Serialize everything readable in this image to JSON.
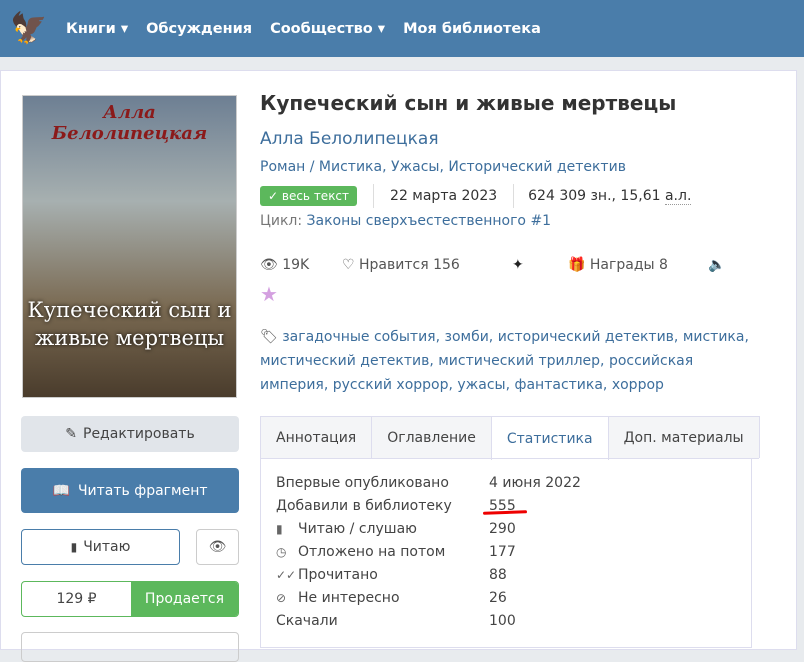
{
  "nav": {
    "items": [
      "Книги ▾",
      "Обсуждения",
      "Сообщество ▾",
      "Моя библиотека"
    ]
  },
  "cover": {
    "author": "Алла Белолипецкая",
    "title": "Купеческий сын и живые мертвецы"
  },
  "book": {
    "title": "Купеческий сын и живые мертвецы",
    "author": "Алла Белолипецкая",
    "genres": "Роман / Мистика, Ужасы, Исторический детектив",
    "status": "весь текст",
    "date": "22 марта 2023",
    "size": "624 309 зн., 15,61",
    "size_unit": "а.л.",
    "cycle_label": "Цикл:",
    "cycle": "Законы сверхъестественного #1",
    "views": "19K",
    "likes": "Нравится 156",
    "awards": "Награды 8",
    "tags": "загадочные события, зомби, исторический детектив, мистика, мистический детектив, мистический триллер, российская империя, русский хоррор, ужасы, фантастика, хоррор"
  },
  "buttons": {
    "edit": "Редактировать",
    "read": "Читать фрагмент",
    "reading": "Читаю",
    "price": "129 ₽",
    "sale": "Продается"
  },
  "tabs": [
    "Аннотация",
    "Оглавление",
    "Статистика",
    "Доп. материалы"
  ],
  "stats": [
    {
      "label": "Впервые опубликовано",
      "value": "4 июня 2022",
      "icon": ""
    },
    {
      "label": "Добавили в библиотеку",
      "value": "555",
      "icon": ""
    },
    {
      "label": "Читаю / слушаю",
      "value": "290",
      "icon": "book-icon"
    },
    {
      "label": "Отложено на потом",
      "value": "177",
      "icon": "clock-icon"
    },
    {
      "label": "Прочитано",
      "value": "88",
      "icon": "double-check-icon"
    },
    {
      "label": "Не интересно",
      "value": "26",
      "icon": "eye-slash-icon"
    },
    {
      "label": "Скачали",
      "value": "100",
      "icon": ""
    }
  ]
}
